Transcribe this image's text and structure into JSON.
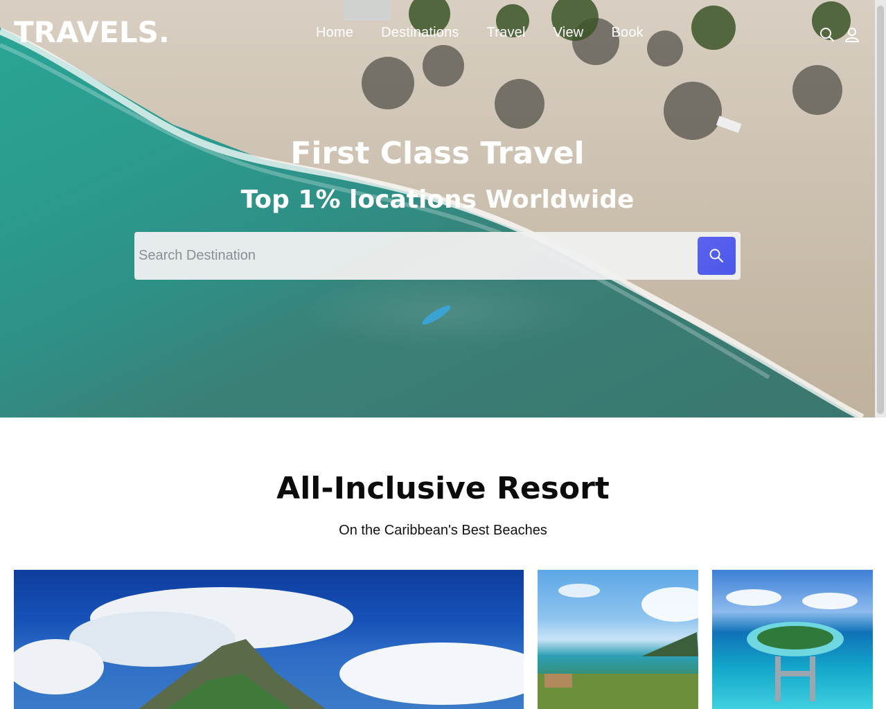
{
  "brand": {
    "logo": "TRAVELS."
  },
  "nav": {
    "items": [
      {
        "label": "Home"
      },
      {
        "label": "Destinations"
      },
      {
        "label": "Travel"
      },
      {
        "label": "View"
      },
      {
        "label": "Book"
      }
    ]
  },
  "header_icons": {
    "search": "search-icon",
    "account": "user-icon"
  },
  "hero": {
    "title": "First Class Travel",
    "subtitle": "Top 1% locations Worldwide",
    "search": {
      "placeholder": "Search Destination",
      "value": ""
    }
  },
  "section": {
    "title": "All-Inclusive Resort",
    "subtitle": "On the Caribbean's Best Beaches"
  },
  "colors": {
    "accent": "#5458ee",
    "text": "#0b0b0b",
    "hero_text": "#ffffff"
  }
}
